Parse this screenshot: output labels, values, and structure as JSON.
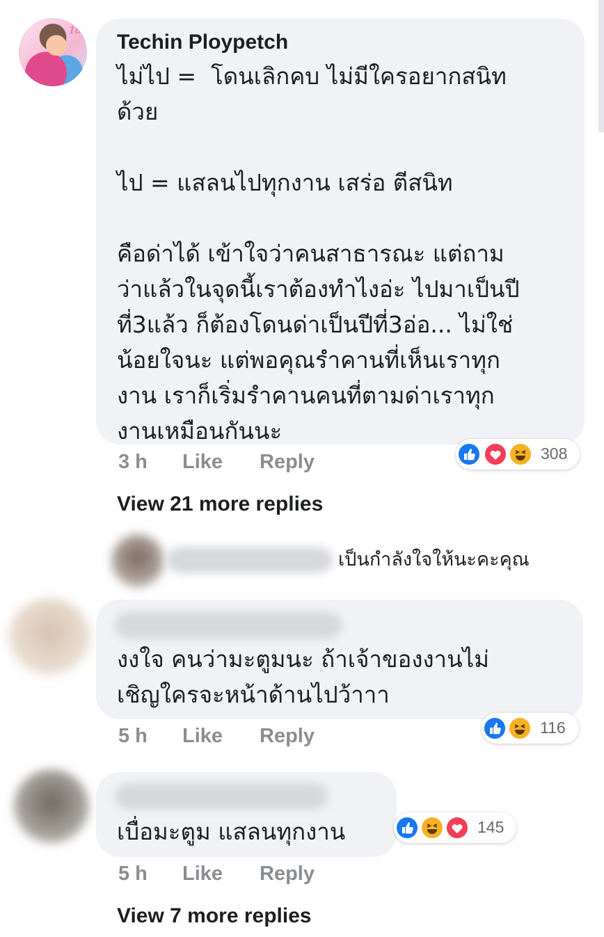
{
  "comments": [
    {
      "author": "Techin Ploypetch",
      "avatar_tag": "18",
      "body": "ไม่ไป =  โดนเลิกคบ ไม่มีใครอยากสนิท\nด้วย\n\nไป = แสลนไปทุกงาน เสร่อ ตีสนิท\n\nคือด่าได้ เข้าใจว่าคนสาธารณะ แต่ถาม\nว่าแล้วในจุดนี้เราต้องทำไงอ่ะ ไปมาเป็นปี\nที่3แล้ว ก็ต้องโดนด่าเป็นปีที่3อ่อ... ไม่ใช่\nน้อยใจนะ แต่พอคุณรำคานที่เห็นเราทุก\nงาน เราก็เริ่มรำคานคนที่ตามด่าเราทุก\nงานเหมือนกันนะ",
      "time": "3 h",
      "like_label": "Like",
      "reply_label": "Reply",
      "reactions": [
        "like-icon",
        "love-icon",
        "haha-icon"
      ],
      "reaction_count": "308"
    }
  ],
  "view_more_1": "View 21 more replies",
  "nested_reply": {
    "body": "เป็นกำลังใจให้นะคะคุณ"
  },
  "comment2": {
    "body": "งงใจ คนว่ามะตูมนะ ถ้าเจ้าของงานไม่\nเชิญใครจะหน้าด้านไปว้าาา",
    "time": "5 h",
    "like_label": "Like",
    "reply_label": "Reply",
    "reactions": [
      "like-icon",
      "haha-icon"
    ],
    "reaction_count": "116"
  },
  "comment3": {
    "body": "เบื่อมะตูม แสลนทุกงาน",
    "time": "5 h",
    "like_label": "Like",
    "reply_label": "Reply",
    "reactions": [
      "like-icon",
      "haha-icon",
      "love-icon"
    ],
    "reaction_count": "145"
  },
  "view_more_2": "View 7 more replies",
  "colors": {
    "bubble": "#f0f2f5",
    "like": "#1877f2",
    "love": "#f33e58",
    "haha": "#f7b125",
    "meta": "#8a8d91"
  }
}
